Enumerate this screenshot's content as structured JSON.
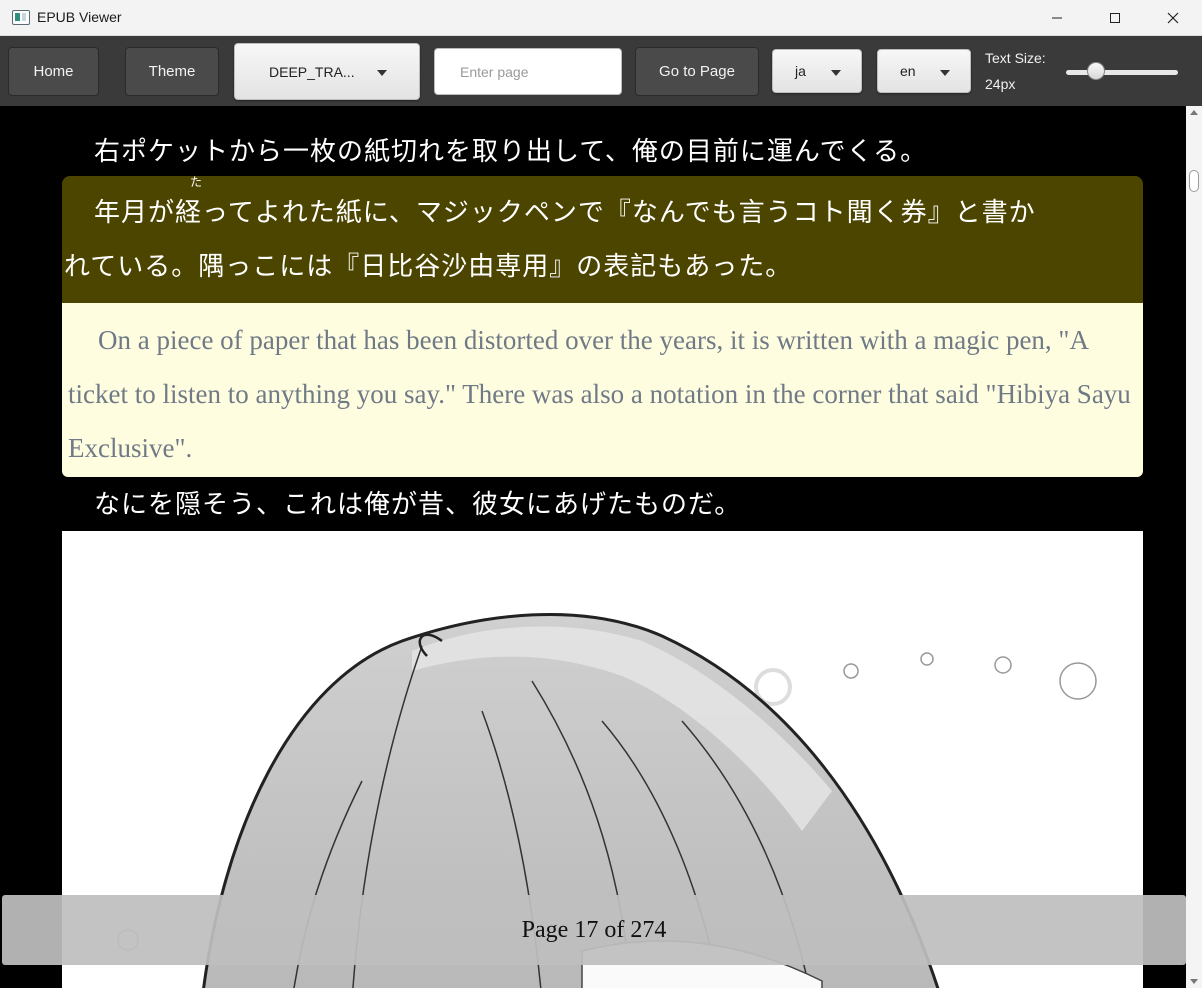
{
  "window": {
    "title": "EPUB Viewer"
  },
  "toolbar": {
    "home_label": "Home",
    "theme_label": "Theme",
    "mode_value": "DEEP_TRA...",
    "page_placeholder": "Enter page",
    "goto_label": "Go to Page",
    "source_lang": "ja",
    "target_lang": "en",
    "text_size_label": "Text Size:",
    "text_size_value": "24px"
  },
  "content": {
    "paragraph_prev": "右ポケットから一枚の紙切れを取り出して、俺の目前に運んでくる。",
    "paragraph_current_line1": "年月が経ってよれた紙に、マジックペンで『なんでも言うコト聞く券』と書か",
    "paragraph_current_line2": "れている。隅っこには『日比谷沙由専用』の表記もあった。",
    "ruby_reading": "た",
    "translation": "On a piece of paper that has been distorted over the years, it is written with a magic pen, \"A ticket to listen to anything you say.\" There was also a notation in the corner that said \"Hibiya Sayu Exclusive\".",
    "paragraph_next": "なにを隠そう、これは俺が昔、彼女にあげたものだ。"
  },
  "footer": {
    "page_indicator": "Page 17 of 274"
  },
  "colors": {
    "highlight": "#4c4500",
    "translation_bg": "#fffde0",
    "translation_text": "#6f7a86",
    "toolbar": "#3a3a3a"
  }
}
